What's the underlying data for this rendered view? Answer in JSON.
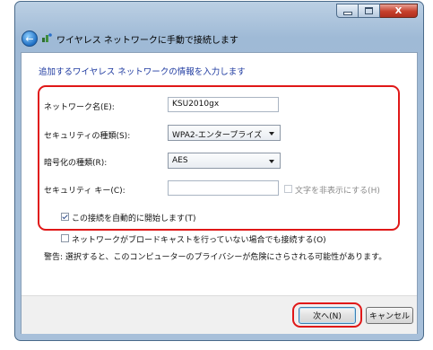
{
  "window": {
    "title": "ワイヤレス ネットワークに手動で接続します",
    "caption_buttons": {
      "minimize": "–",
      "maximize": "□",
      "close": "X"
    }
  },
  "content": {
    "heading": "追加するワイヤレス ネットワークの情報を入力します",
    "fields": {
      "network_name": {
        "label": "ネットワーク名(E):",
        "value": "KSU2010gx"
      },
      "security_type": {
        "label": "セキュリティの種類(S):",
        "selected": "WPA2-エンタープライズ"
      },
      "encryption_type": {
        "label": "暗号化の種類(R):",
        "selected": "AES"
      },
      "security_key": {
        "label": "セキュリティ キー(C):",
        "value": ""
      }
    },
    "hide_chars_checkbox": {
      "label": "文字を非表示にする(H)",
      "checked": false,
      "enabled": false
    },
    "auto_connect_checkbox": {
      "label": "この接続を自動的に開始します(T)",
      "checked": true
    },
    "connect_nonbroadcast_checkbox": {
      "label": "ネットワークがブロードキャストを行っていない場合でも接続する(O)",
      "checked": false
    },
    "warning": "警告: 選択すると、このコンピューターのプライバシーが危険にさらされる可能性があります。"
  },
  "buttons": {
    "next": "次へ(N)",
    "cancel": "キャンセル"
  },
  "colors": {
    "highlight": "#e01818",
    "heading": "#1e3aa0",
    "next_focus": "#3c7fb1"
  }
}
